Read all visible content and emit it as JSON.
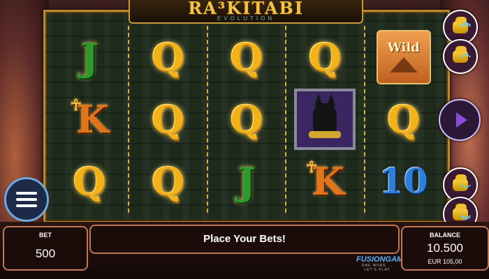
{
  "game": {
    "logo_text": "RA³KITABI",
    "logo_sub": "EVOLUTION"
  },
  "reels": [
    [
      {
        "kind": "j",
        "label": "J"
      },
      {
        "kind": "k",
        "label": "K",
        "ankh": true
      },
      {
        "kind": "q",
        "label": "Q"
      }
    ],
    [
      {
        "kind": "q",
        "label": "Q"
      },
      {
        "kind": "q",
        "label": "Q"
      },
      {
        "kind": "q",
        "label": "Q"
      }
    ],
    [
      {
        "kind": "q",
        "label": "Q"
      },
      {
        "kind": "q",
        "label": "Q"
      },
      {
        "kind": "j",
        "label": "J"
      }
    ],
    [
      {
        "kind": "q",
        "label": "Q"
      },
      {
        "kind": "anubis",
        "label": ""
      },
      {
        "kind": "k",
        "label": "K",
        "ankh": true
      }
    ],
    [
      {
        "kind": "wild",
        "label": "Wild"
      },
      {
        "kind": "q",
        "label": "Q"
      },
      {
        "kind": "ten",
        "label": "10"
      }
    ]
  ],
  "bottom": {
    "bet_label": "BET",
    "bet_value": "500",
    "message": "Place Your Bets!",
    "balance_label": "BALANCE",
    "balance_value": "10.500",
    "balance_eur": "EUR 105,00"
  },
  "brand": {
    "name": "FUSIONGAME",
    "tagline": "ONE MORE ... LET'S PLAY"
  },
  "icons": {
    "bet_up": "coins-up-double-icon",
    "bet_up_small": "coins-up-icon",
    "play": "play-icon",
    "bet_down_small": "coins-down-icon",
    "bet_down": "coins-down-double-icon",
    "menu": "hamburger-menu-icon"
  },
  "colors": {
    "accent_gold": "#f2b21a",
    "frame": "#b8892e",
    "menu_border": "#6fa8e0"
  }
}
